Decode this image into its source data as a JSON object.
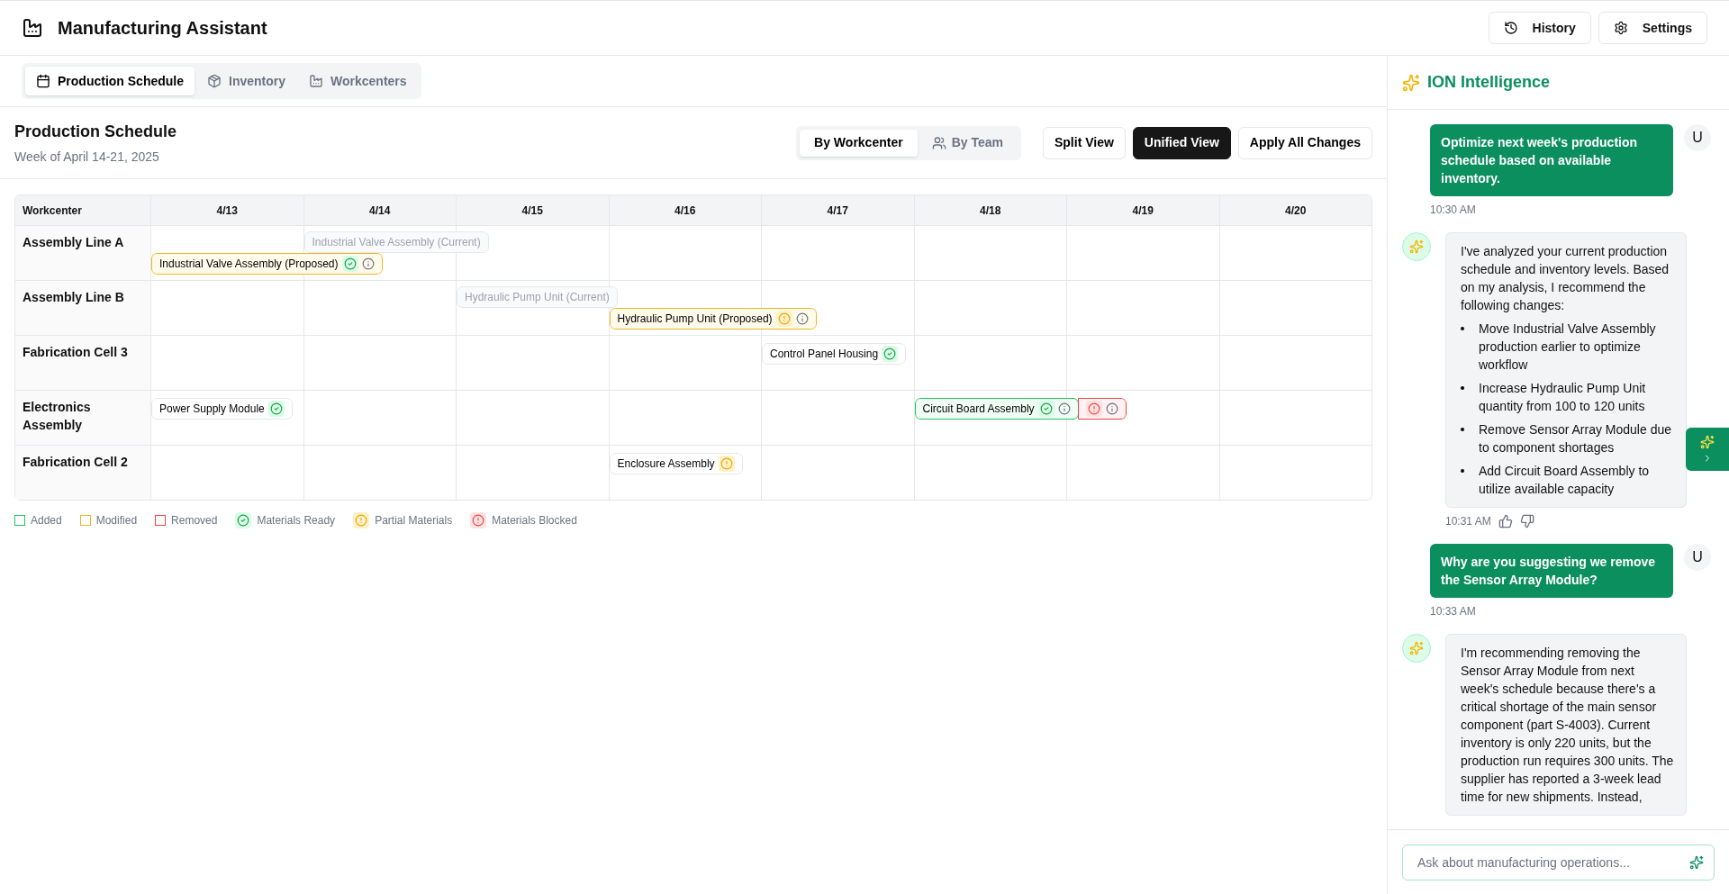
{
  "app": {
    "title": "Manufacturing Assistant",
    "buttons": [
      {
        "kind": "history",
        "label": "History"
      },
      {
        "kind": "settings",
        "label": "Settings"
      }
    ]
  },
  "tabs": [
    {
      "kind": "calendar",
      "label": "Production Schedule",
      "selected": true
    },
    {
      "kind": "box",
      "label": "Inventory",
      "selected": false
    },
    {
      "kind": "factory",
      "label": "Workcenters",
      "selected": false
    }
  ],
  "schedule": {
    "title": "Production Schedule",
    "subtitle": "Week of April 14-21, 2025",
    "group_by": [
      {
        "kind": "plain",
        "label": "By Workcenter",
        "selected": true
      },
      {
        "kind": "users",
        "label": "By Team",
        "selected": false
      }
    ],
    "views": [
      {
        "label": "Split View",
        "selected": false
      },
      {
        "label": "Unified View",
        "selected": true
      },
      {
        "label": "Apply All Changes",
        "selected": false
      }
    ],
    "columns": [
      "Workcenter",
      "4/13",
      "4/14",
      "4/15",
      "4/16",
      "4/17",
      "4/18",
      "4/19",
      "4/20"
    ],
    "rows": [
      {
        "cells": [
          {
            "text": "Assembly Line A"
          },
          {
            "bars": [
              {
                "kind": "proposed",
                "label": "Industrial Valve Assembly (Proposed)",
                "icons": [
                  {
                    "kind": "ready"
                  },
                  {
                    "kind": "info"
                  }
                ]
              }
            ]
          },
          {
            "bars": [
              {
                "kind": "current",
                "label": "Industrial Valve Assembly (Current)"
              }
            ]
          },
          {},
          {},
          {},
          {},
          {},
          {}
        ]
      },
      {
        "cells": [
          {
            "text": "Assembly Line B"
          },
          {},
          {},
          {
            "bars": [
              {
                "kind": "current",
                "label": "Hydraulic Pump Unit (Current)"
              }
            ]
          },
          {
            "bars": [
              {
                "kind": "proposed",
                "label": "Hydraulic Pump Unit (Proposed)",
                "icons": [
                  {
                    "kind": "partial"
                  },
                  {
                    "kind": "info"
                  }
                ]
              }
            ]
          },
          {},
          {},
          {},
          {}
        ]
      },
      {
        "cells": [
          {
            "text": "Fabrication Cell 3"
          },
          {},
          {},
          {},
          {},
          {
            "bars": [
              {
                "kind": "unchanged",
                "label": "Control Panel Housing",
                "icons": [
                  {
                    "kind": "ready"
                  }
                ]
              }
            ]
          },
          {},
          {},
          {}
        ]
      },
      {
        "cells": [
          {
            "text": "Electronics Assembly"
          },
          {
            "bars": [
              {
                "kind": "unchanged",
                "label": "Power Supply Module",
                "icons": [
                  {
                    "kind": "ready"
                  }
                ]
              }
            ]
          },
          {},
          {},
          {},
          {},
          {
            "bars": [
              {
                "kind": "added",
                "label": "Circuit Board Assembly",
                "icons": [
                  {
                    "kind": "ready"
                  },
                  {
                    "kind": "info"
                  }
                ]
              },
              {
                "kind": "removed",
                "icons": [
                  {
                    "kind": "blocked"
                  },
                  {
                    "kind": "info"
                  }
                ]
              }
            ]
          },
          {},
          {}
        ]
      },
      {
        "cells": [
          {
            "text": "Fabrication Cell 2"
          },
          {},
          {},
          {},
          {
            "bars": [
              {
                "kind": "unchanged",
                "label": "Enclosure Assembly",
                "icons": [
                  {
                    "kind": "partial"
                  }
                ]
              }
            ]
          },
          {},
          {},
          {},
          {}
        ]
      }
    ],
    "legend": [
      {
        "kind": "added",
        "label": "Added"
      },
      {
        "kind": "modified",
        "label": "Modified"
      },
      {
        "kind": "removed",
        "label": "Removed"
      },
      {
        "kind": "ready",
        "label": "Materials Ready"
      },
      {
        "kind": "partial",
        "label": "Partial Materials"
      },
      {
        "kind": "blocked",
        "label": "Materials Blocked"
      }
    ]
  },
  "assistant": {
    "title": "ION Intelligence",
    "messages": [
      {
        "kind": "user",
        "avatar": "U",
        "text": "Optimize next week's production schedule based on available inventory.",
        "time": "10:30 AM"
      },
      {
        "kind": "assistant",
        "text": "I've analyzed your current production schedule and inventory levels. Based on my analysis, I recommend the following changes:",
        "bullets": [
          "Move Industrial Valve Assembly production earlier to optimize workflow",
          "Increase Hydraulic Pump Unit quantity from 100 to 120 units",
          "Remove Sensor Array Module due to component shortages",
          "Add Circuit Board Assembly to utilize available capacity"
        ],
        "time": "10:31 AM",
        "feedback": true
      },
      {
        "kind": "user",
        "avatar": "U",
        "text": "Why are you suggesting we remove the Sensor Array Module?",
        "time": "10:33 AM"
      },
      {
        "kind": "assistant",
        "text": "I'm recommending removing the Sensor Array Module from next week's schedule because there's a critical shortage of the main sensor component (part S-4003). Current inventory is only 220 units, but the production run requires 300 units. The supplier has reported a 3-week lead time for new shipments. Instead,"
      }
    ],
    "input": {
      "placeholder": "Ask about manufacturing operations..."
    }
  }
}
